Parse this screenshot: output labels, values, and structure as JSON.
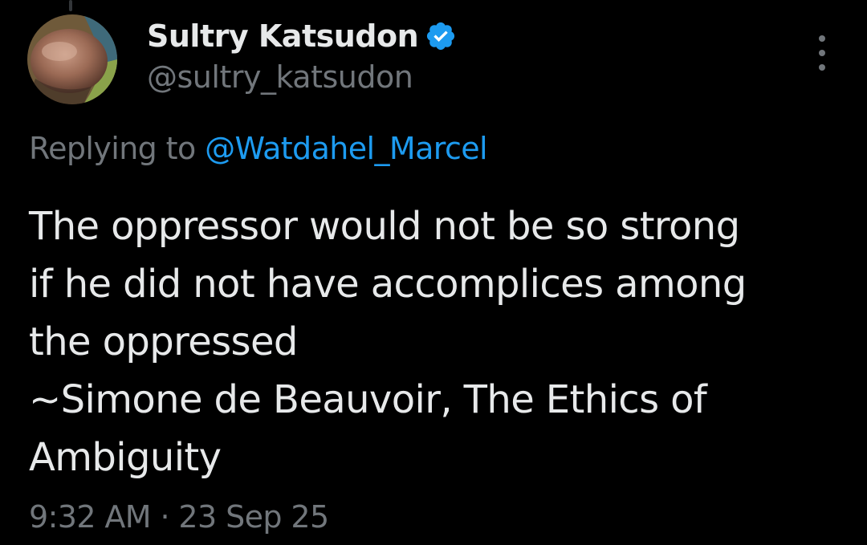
{
  "author": {
    "display_name": "Sultry Katsudon",
    "handle": "@sultry_katsudon",
    "verified": true,
    "avatar_icon": "profile-photo"
  },
  "reply": {
    "prefix": "Replying to ",
    "mention": "@Watdahel_Marcel"
  },
  "tweet": {
    "lines": [
      "The oppressor would not be so strong",
      "if he did not have accomplices among",
      "the oppressed",
      "~Simone de Beauvoir, The Ethics of",
      "Ambiguity"
    ]
  },
  "meta": {
    "timestamp": "9:32 AM · 23 Sep 25"
  },
  "icons": {
    "verified": "verified-badge-icon",
    "more": "more-options-icon"
  },
  "colors": {
    "background": "#000000",
    "primary_text": "#e7e9ea",
    "secondary_text": "#71767b",
    "accent": "#1d9bf0"
  }
}
